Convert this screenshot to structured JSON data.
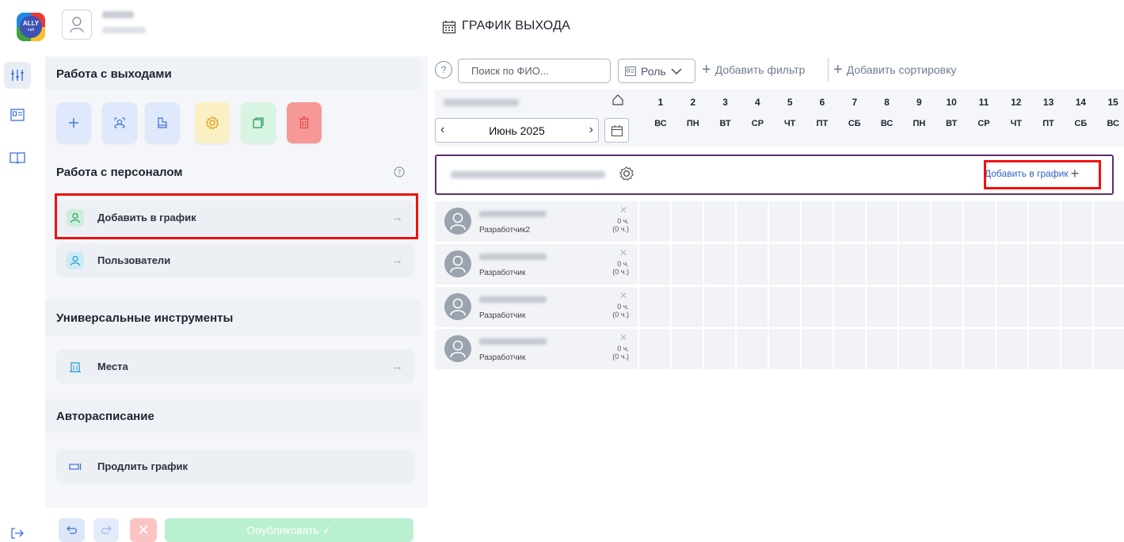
{
  "app": {
    "logo_text": "ALLY",
    "logo_sub": "soft"
  },
  "page": {
    "title": "ГРАФИК ВЫХОДА"
  },
  "sections": {
    "work_exits": "Работа с выходами",
    "staff": "Работа с персоналом",
    "universal_tools": "Универсальные инструменты",
    "autoschedule": "Авторасписание"
  },
  "tool_buttons": [
    {
      "name": "add-exit-button",
      "icon": "plus-icon",
      "bg": "#dfe9fb",
      "color": "#3b6fd6"
    },
    {
      "name": "search-exit-button",
      "icon": "search-person-icon",
      "bg": "#dfe9fb",
      "color": "#3b6fd6"
    },
    {
      "name": "copy-template-button",
      "icon": "clipboard-icon",
      "bg": "#dfe9fb",
      "color": "#3b6fd6"
    },
    {
      "name": "settings-exit-button",
      "icon": "gear-icon",
      "bg": "#fbf0c4",
      "color": "#e09a10"
    },
    {
      "name": "duplicate-button",
      "icon": "copy-icon",
      "bg": "#d8f4e2",
      "color": "#2a9d5b"
    },
    {
      "name": "delete-button",
      "icon": "trash-icon",
      "bg": "#f69898",
      "color": "#e44646"
    }
  ],
  "staff_items": [
    {
      "label": "Добавить в график",
      "icon": "person-icon"
    },
    {
      "label": "Пользователи",
      "icon": "person-icon"
    }
  ],
  "tools_items": [
    {
      "label": "Места",
      "icon": "building-icon"
    }
  ],
  "auto_items": [
    {
      "label": "Продлить график",
      "icon": "extend-icon"
    }
  ],
  "toolbar": {
    "search_placeholder": "Поиск по ФИО...",
    "role_label": "Роль",
    "add_filter": "Добавить фильтр",
    "add_sort": "Добавить сортировку"
  },
  "calendar": {
    "month": "Июнь 2025",
    "days": [
      {
        "num": "1",
        "dow": "ВС"
      },
      {
        "num": "2",
        "dow": "ПН"
      },
      {
        "num": "3",
        "dow": "ВТ"
      },
      {
        "num": "4",
        "dow": "СР"
      },
      {
        "num": "5",
        "dow": "ЧТ"
      },
      {
        "num": "6",
        "dow": "ПТ"
      },
      {
        "num": "7",
        "dow": "СБ"
      },
      {
        "num": "8",
        "dow": "ВС"
      },
      {
        "num": "9",
        "dow": "ПН"
      },
      {
        "num": "10",
        "dow": "ВТ"
      },
      {
        "num": "11",
        "dow": "СР"
      },
      {
        "num": "12",
        "dow": "ЧТ"
      },
      {
        "num": "13",
        "dow": "ПТ"
      },
      {
        "num": "14",
        "dow": "СБ"
      },
      {
        "num": "15",
        "dow": "ВС"
      }
    ]
  },
  "group": {
    "add_label": "Добавить в график"
  },
  "employees": [
    {
      "role": "Разработчик2",
      "hours": "0 ч.",
      "hours_total": "(0 ч.)"
    },
    {
      "role": "Разработчик",
      "hours": "0 ч.",
      "hours_total": "(0 ч.)"
    },
    {
      "role": "Разработчик",
      "hours": "0 ч.",
      "hours_total": "(0 ч.)"
    },
    {
      "role": "Разработчик",
      "hours": "0 ч.",
      "hours_total": "(0 ч.)"
    }
  ],
  "bottom": {
    "publish_label": "Опубликовать ✓"
  },
  "colors": {
    "highlight": "#ee1111",
    "group_border": "#5c2d6e",
    "link": "#2f63c4"
  }
}
